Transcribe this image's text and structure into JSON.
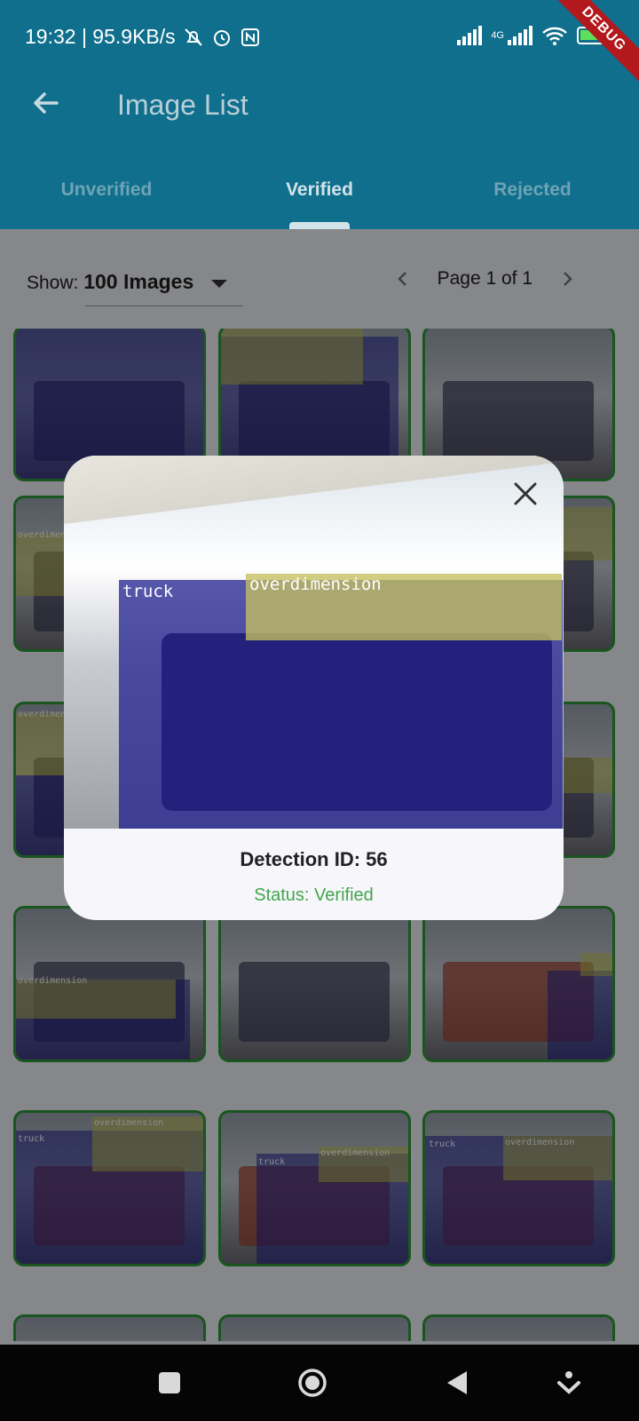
{
  "statusbar": {
    "time_speed": "19:32 | 95.9KB/s",
    "network_type": "4G",
    "debug_ribbon": "DEBUG"
  },
  "appbar": {
    "title": "Image List",
    "back_icon": "arrow-left-icon"
  },
  "tabs": [
    {
      "label": "Unverified",
      "active": false
    },
    {
      "label": "Verified",
      "active": true
    },
    {
      "label": "Rejected",
      "active": false
    }
  ],
  "filter": {
    "show_label": "Show:",
    "show_value": "100 Images",
    "page_text": "Page 1 of 1"
  },
  "grid": {
    "label_overdimension": "overdimension",
    "label_truck": "truck"
  },
  "dialog": {
    "labels": {
      "truck": "truck",
      "overdimension": "overdimension"
    },
    "detection_title": "Detection ID: 56",
    "status_text": "Status: Verified"
  },
  "colors": {
    "appbar": "#0f6f8c",
    "verified_green": "#43a64a",
    "tile_border": "#2f9b3a"
  }
}
